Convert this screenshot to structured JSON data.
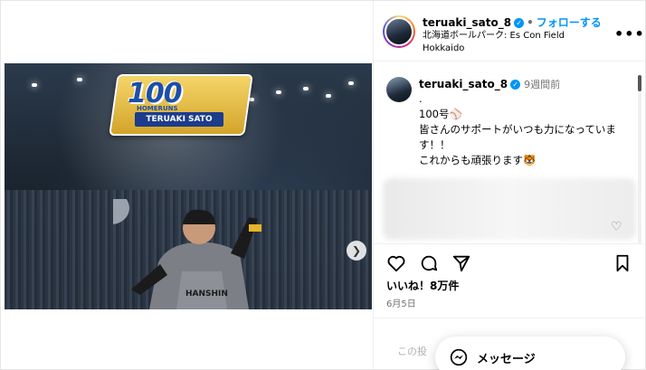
{
  "post": {
    "image_badge": {
      "title": "100",
      "subtitle": "HOMERUNS",
      "name": "TERUAKI SATO"
    },
    "jersey_text": "HANSHIN"
  },
  "header": {
    "username": "teruaki_sato_8",
    "separator": "•",
    "follow_label": "フォローする",
    "location": "北海道ボールパーク: Es Con Field Hokkaido",
    "more_icon": "more-horizontal-icon"
  },
  "caption": {
    "username": "teruaki_sato_8",
    "time": "9週間前",
    "text": ".\n100号⚾\n皆さんのサポートがいつも力になっています！！\nこれからも頑張ります🐯"
  },
  "actions": {
    "like_icon": "heart-icon",
    "comment_icon": "comment-icon",
    "share_icon": "share-icon",
    "save_icon": "bookmark-icon"
  },
  "likes": "いいね！8万件",
  "date": "6月5日",
  "comment_box": {
    "placeholder": "この投"
  },
  "message_button": {
    "label": "メッセージ"
  }
}
